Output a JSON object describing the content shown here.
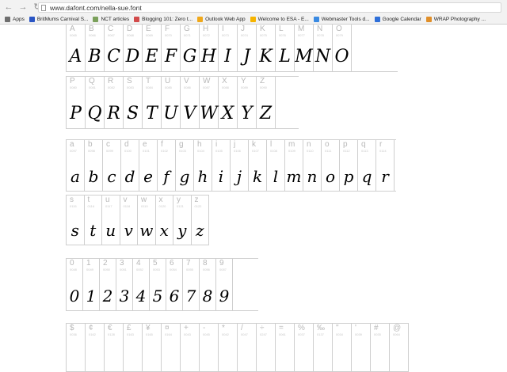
{
  "browser": {
    "url": "www.dafont.com/nella-sue.font",
    "bookmarks": [
      {
        "label": "Apps",
        "color": "#6e6e6e"
      },
      {
        "label": "BritMums Carnival S...",
        "color": "#2a55c4"
      },
      {
        "label": "NCT articles",
        "color": "#7ba05b"
      },
      {
        "label": "Blogging 101: Zero t...",
        "color": "#d24b4b"
      },
      {
        "label": "Outlook Web App",
        "color": "#f0a81a"
      },
      {
        "label": "Welcome to ESA - E...",
        "color": "#f6b400"
      },
      {
        "label": "Webmaster Tools d...",
        "color": "#3a8ae2"
      },
      {
        "label": "Google Calendar",
        "color": "#2e6fd9"
      },
      {
        "label": "WRAP Photography ...",
        "color": "#e08f2a"
      }
    ]
  },
  "rows": [
    {
      "id": "upper1",
      "chars": [
        "A",
        "B",
        "C",
        "D",
        "E",
        "F",
        "G",
        "H",
        "I",
        "J",
        "K",
        "L",
        "M",
        "N",
        "O"
      ],
      "codes": [
        "0065",
        "0066",
        "0067",
        "0068",
        "0069",
        "0070",
        "0071",
        "0072",
        "0073",
        "0074",
        "0075",
        "0076",
        "0077",
        "0078",
        "0079"
      ]
    },
    {
      "id": "upper2",
      "chars": [
        "P",
        "Q",
        "R",
        "S",
        "T",
        "U",
        "V",
        "W",
        "X",
        "Y",
        "Z"
      ],
      "codes": [
        "0080",
        "0081",
        "0082",
        "0083",
        "0084",
        "0085",
        "0086",
        "0087",
        "0088",
        "0089",
        "0090"
      ]
    },
    {
      "id": "lower1",
      "chars": [
        "a",
        "b",
        "c",
        "d",
        "e",
        "f",
        "g",
        "h",
        "i",
        "j",
        "k",
        "l",
        "m",
        "n",
        "o",
        "p",
        "q",
        "r"
      ],
      "codes": [
        "0097",
        "0098",
        "0099",
        "0100",
        "0101",
        "0102",
        "0103",
        "0104",
        "0105",
        "0106",
        "0107",
        "0108",
        "0109",
        "0110",
        "0111",
        "0112",
        "0113",
        "0114"
      ]
    },
    {
      "id": "lower2",
      "chars": [
        "s",
        "t",
        "u",
        "v",
        "w",
        "x",
        "y",
        "z"
      ],
      "codes": [
        "0115",
        "0116",
        "0117",
        "0118",
        "0119",
        "0120",
        "0121",
        "0122"
      ]
    },
    {
      "id": "digits",
      "chars": [
        "0",
        "1",
        "2",
        "3",
        "4",
        "5",
        "6",
        "7",
        "8",
        "9"
      ],
      "codes": [
        "0048",
        "0049",
        "0050",
        "0051",
        "0052",
        "0053",
        "0054",
        "0055",
        "0056",
        "0057"
      ]
    },
    {
      "id": "symbols",
      "chars": [
        "$",
        "¢",
        "€",
        "£",
        "¥",
        "¤",
        "+",
        "-",
        "*",
        "/",
        "÷",
        "=",
        "%",
        "‰",
        "\"",
        "'",
        "#",
        "@"
      ],
      "codes": [
        "0036",
        "0162",
        "0128",
        "0163",
        "0165",
        "0164",
        "0043",
        "0045",
        "0042",
        "0047",
        "0247",
        "0061",
        "0037",
        "0137",
        "0034",
        "0039",
        "0035",
        "0064"
      ]
    }
  ]
}
